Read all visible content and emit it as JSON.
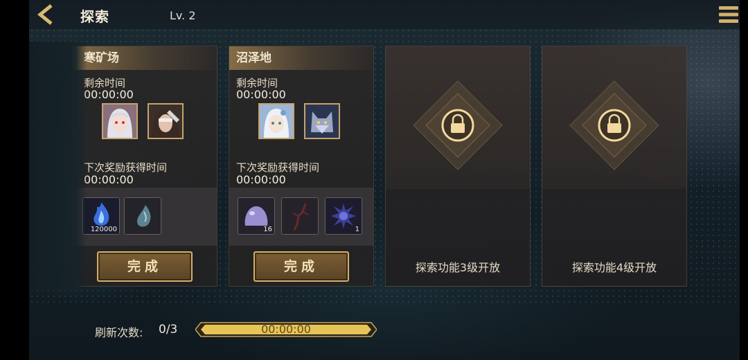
{
  "header": {
    "title": "探索",
    "level": "Lv. 2"
  },
  "cards": [
    {
      "name": "寒矿场",
      "remaining_label": "剩余时间",
      "remaining_value": "00:00:00",
      "next_reward_label": "下次奖励获得时间",
      "next_reward_value": "00:00:00",
      "rewards": [
        {
          "icon": "blue-flame-icon",
          "count": "120000"
        },
        {
          "icon": "water-drop-icon",
          "count": ""
        }
      ],
      "button_label": "完成"
    },
    {
      "name": "沼泽地",
      "remaining_label": "剩余时间",
      "remaining_value": "00:00:00",
      "next_reward_label": "下次奖励获得时间",
      "next_reward_value": "00:00:00",
      "rewards": [
        {
          "icon": "slime-icon",
          "count": "16"
        },
        {
          "icon": "branch-icon",
          "count": ""
        },
        {
          "icon": "spiky-orb-icon",
          "count": "1"
        }
      ],
      "button_label": "完成"
    }
  ],
  "locked": [
    {
      "text": "探索功能3级开放"
    },
    {
      "text": "探索功能4级开放"
    }
  ],
  "footer": {
    "refresh_label": "刷新次数:",
    "refresh_count": "0/3",
    "timer": "00:00:00"
  },
  "colors": {
    "gold": "#c9a25a",
    "bar": "#e7c456"
  }
}
